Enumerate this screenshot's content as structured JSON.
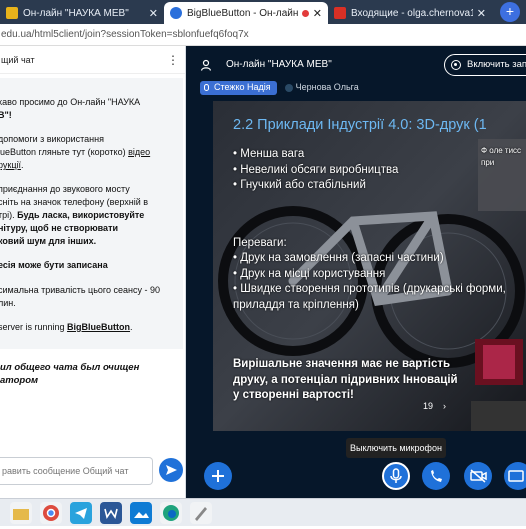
{
  "browser": {
    "tabs": [
      {
        "title": "Он-лайн \"НАУКА МЕВ\"",
        "active": false
      },
      {
        "title": "BigBlueButton - Он-лайн \"Н",
        "active": true
      },
      {
        "title": "Входящие - olga.chernova1974@",
        "active": false
      }
    ],
    "url": "edu.ua/html5client/join?sessionToken=sblonfuefq6foq7x"
  },
  "chat": {
    "header": "щий чат",
    "welcome": {
      "p1": "каво просимо до Он-лайн \"НАУКА",
      "p1b": "В\"!",
      "p2a": "допомоги з використання",
      "p2b": "lueButton гляньте тут (коротко) ",
      "p2link": "відео",
      "p2c": "рукції",
      "p3a": "приєднання до звукового мосту",
      "p3b": "сніть на значок телефону (верхній в",
      "p3c": "трі). ",
      "p3d": "Будь ласка, використовуйте",
      "p3e": "нітуру, щоб не створювати",
      "p3f": "ковий шум для інших.",
      "p4": "есія може бути записана",
      "p5a": "симальна тривалість цього сеансу - 90",
      "p5b": "лин.",
      "p6a": "server is running ",
      "p6link": "BigBlueButton"
    },
    "cleared": "ил общего чата был очищен",
    "cleared2": "атором",
    "input_placeholder": "равить сообщение Общий чат"
  },
  "stage": {
    "meeting_name": "Он-лайн \"НАУКА МЕВ\"",
    "record_label": "Включить запис",
    "speakers": [
      {
        "name": "Стежко Надія",
        "talking": true
      },
      {
        "name": "Чернова Ольга",
        "talking": false
      }
    ],
    "slide": {
      "title": "2.2 Приклади Індустрії 4.0: 3D-друк (1",
      "bullets1": [
        "Менша вага",
        "Невеликі обсяги виробництва",
        "Гнучкий або стабільний"
      ],
      "advantages": "Переваги:",
      "bullets2": [
        "Друк на замовлення (запасні частини)",
        "Друк на місці користування",
        "Швидке створення прототипів (друкарські форми, приладдя та кріплення)"
      ],
      "conclusion": "Вирішальне значення має не вартість друку, а потенціал підривних Інновацій у створенні вартості!",
      "side_text": "Ф оле тисс при"
    },
    "slide_page": "19",
    "tooltip": "Выключить микрофон"
  },
  "colors": {
    "primary": "#1f71d9",
    "stage_bg": "#06172a",
    "slide_title": "#6db8f2"
  }
}
